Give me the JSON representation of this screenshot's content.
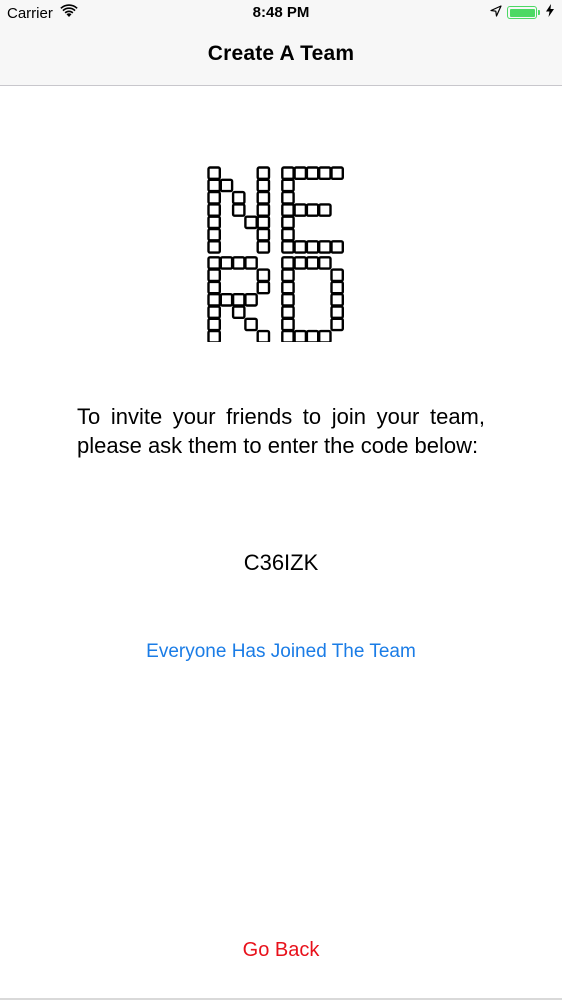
{
  "status_bar": {
    "carrier": "Carrier",
    "time": "8:48 PM"
  },
  "nav": {
    "title": "Create A Team"
  },
  "logo": {
    "alt": "NERD"
  },
  "main": {
    "instructions": "To invite your friends to join your team, please ask them to enter the code below:",
    "team_code": "C36IZK",
    "joined_link": "Everyone Has Joined The Team",
    "go_back": "Go Back"
  },
  "colors": {
    "link_blue": "#1a7ce6",
    "go_back_red": "#e8111b",
    "battery_green": "#4cd964"
  }
}
